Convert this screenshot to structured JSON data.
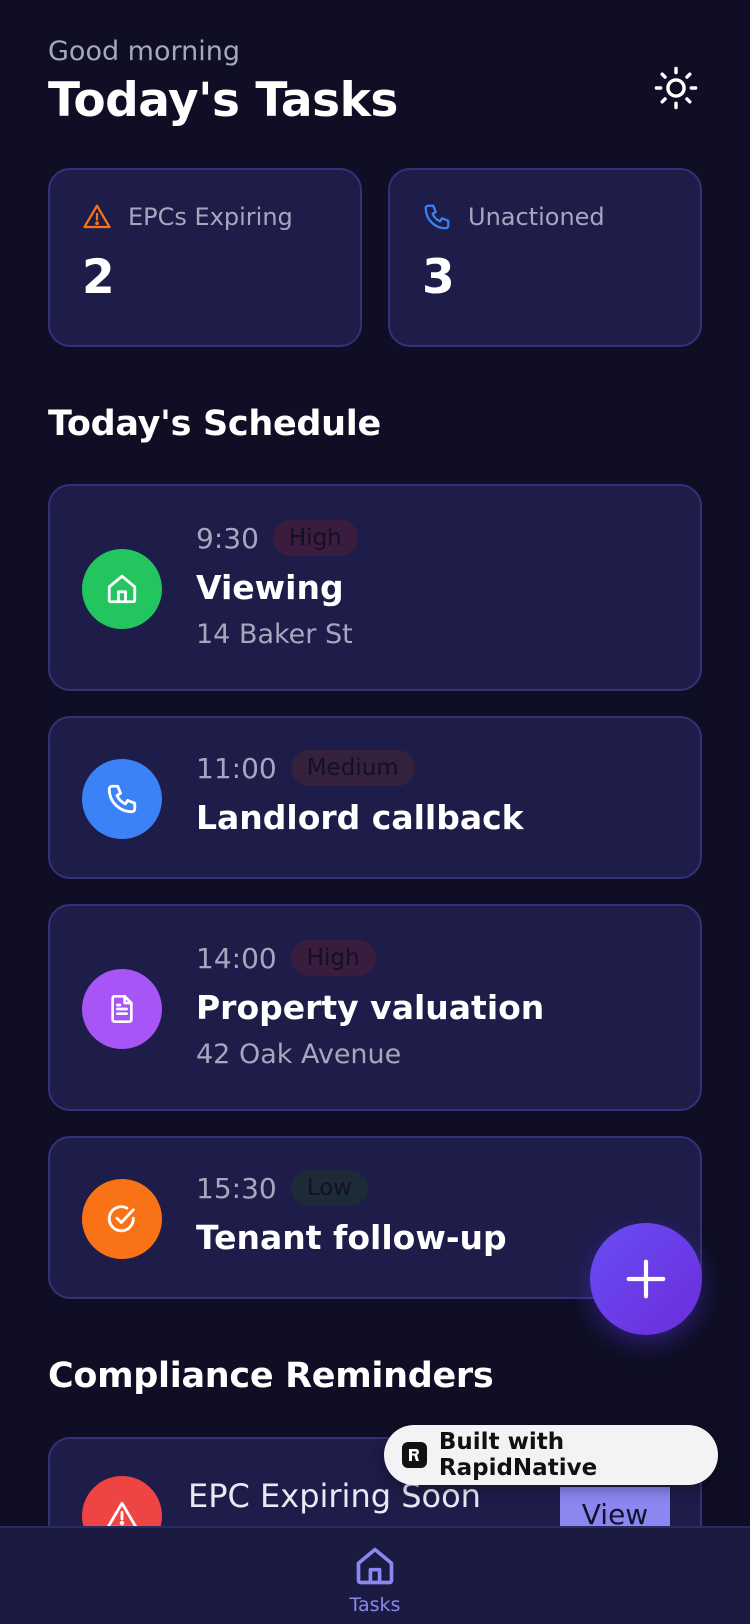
{
  "header": {
    "greeting": "Good morning",
    "title": "Today's Tasks"
  },
  "stats": [
    {
      "label": "EPCs Expiring",
      "value": "2",
      "icon": "warning-icon"
    },
    {
      "label": "Unactioned",
      "value": "3",
      "icon": "phone-icon"
    }
  ],
  "schedule": {
    "title": "Today's Schedule",
    "items": [
      {
        "time": "9:30",
        "priority": "High",
        "title": "Viewing",
        "subtitle": "14 Baker St",
        "icon": "home-icon",
        "color": "#22c55e"
      },
      {
        "time": "11:00",
        "priority": "Medium",
        "title": "Landlord callback",
        "subtitle": "",
        "icon": "phone-icon",
        "color": "#3b82f6"
      },
      {
        "time": "14:00",
        "priority": "High",
        "title": "Property valuation",
        "subtitle": "42 Oak Avenue",
        "icon": "document-icon",
        "color": "#a855f7"
      },
      {
        "time": "15:30",
        "priority": "Low",
        "title": "Tenant follow-up",
        "subtitle": "",
        "icon": "check-circle-icon",
        "color": "#f97316"
      }
    ]
  },
  "compliance": {
    "title": "Compliance Reminders",
    "items": [
      {
        "title": "EPC Expiring Soon",
        "action": "View",
        "icon": "warning-icon",
        "color": "#ef4444"
      }
    ]
  },
  "badge": {
    "text": "Built with RapidNative"
  },
  "nav": {
    "items": [
      {
        "label": "Tasks",
        "icon": "home-icon"
      }
    ]
  },
  "colors": {
    "background": "#0f0e24",
    "card": "#1e1c48",
    "accent": "#8b87f0"
  }
}
